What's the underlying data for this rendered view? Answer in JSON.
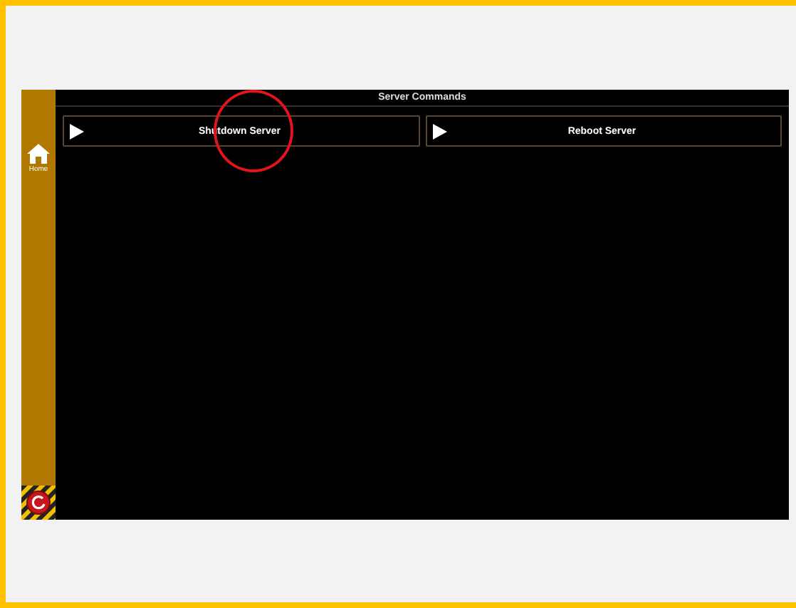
{
  "sidebar": {
    "items": [
      {
        "label": "Home",
        "selected": false
      }
    ]
  },
  "panel": {
    "title": "Server Commands"
  },
  "commands": [
    {
      "label": "Shutdown Server",
      "highlighted": true
    },
    {
      "label": "Reboot Server",
      "highlighted": false
    }
  ]
}
